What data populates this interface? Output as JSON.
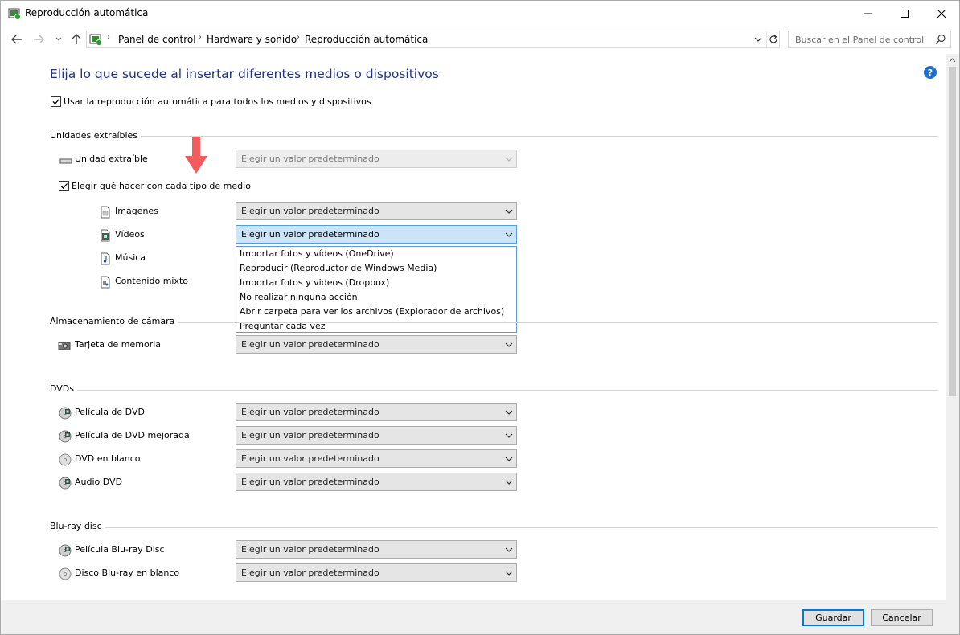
{
  "window": {
    "title": "Reproducción automática"
  },
  "nav": {
    "breadcrumbs": [
      "Panel de control",
      "Hardware y sonido",
      "Reproducción automática"
    ],
    "search_placeholder": "Buscar en el Panel de control"
  },
  "page": {
    "title": "Elija lo que sucede al insertar diferentes medios o dispositivos",
    "use_autoplay_label": "Usar la reproducción automática para todos los medios y dispositivos",
    "use_autoplay_checked": true
  },
  "default_value": "Elegir un valor predeterminado",
  "sections": {
    "removable": {
      "title": "Unidades extraíbles",
      "unit_label": "Unidad extraíble",
      "choose_label": "Elegir qué hacer con cada tipo de medio",
      "choose_checked": true,
      "media": {
        "images": "Imágenes",
        "videos": "Vídeos",
        "music": "Música",
        "mixed": "Contenido mixto"
      }
    },
    "camera": {
      "title": "Almacenamiento de cámara",
      "memory_card": "Tarjeta de memoria"
    },
    "dvds": {
      "title": "DVDs",
      "dvd_movie": "Película de DVD",
      "dvd_enhanced": "Película de DVD mejorada",
      "dvd_blank": "DVD en blanco",
      "dvd_audio": "Audio DVD"
    },
    "bluray": {
      "title": "Blu-ray disc",
      "bluray_movie": "Película Blu-ray Disc",
      "bluray_blank": "Disco Blu-ray en blanco"
    }
  },
  "videos_menu": {
    "options": [
      "Importar fotos y vídeos (OneDrive)",
      "Reproducir (Reproductor de Windows Media)",
      "Importar fotos y videos (Dropbox)",
      "No realizar ninguna acción",
      "Abrir carpeta para ver los archivos (Explorador de archivos)",
      "Preguntar cada vez"
    ]
  },
  "footer": {
    "save": "Guardar",
    "cancel": "Cancelar"
  },
  "colors": {
    "title_blue": "#1e3287",
    "accent": "#0078d7",
    "annotation_arrow": "#f25c5c"
  }
}
